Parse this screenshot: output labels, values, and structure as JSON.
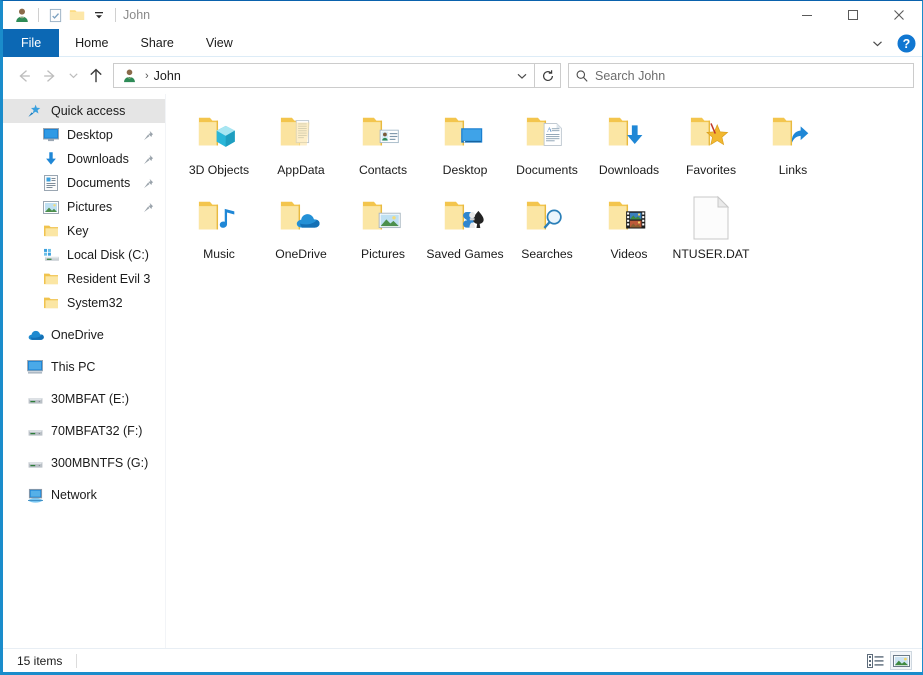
{
  "window": {
    "title": "John",
    "accent_color": "#1a8ccb",
    "tab_active_color": "#0c68b4",
    "selection_color": "#e5e5e5"
  },
  "quick_access_toolbar": {
    "items": [
      {
        "name": "user-account-icon",
        "label": ""
      },
      {
        "name": "properties-icon",
        "label": ""
      },
      {
        "name": "new-folder-icon",
        "label": ""
      },
      {
        "name": "customize-dropdown-icon",
        "label": ""
      }
    ]
  },
  "window_controls": {
    "minimize": "—",
    "maximize": "□",
    "close": "✕"
  },
  "ribbon": {
    "tabs": [
      {
        "label": "File",
        "active": true
      },
      {
        "label": "Home",
        "active": false
      },
      {
        "label": "Share",
        "active": false
      },
      {
        "label": "View",
        "active": false
      }
    ],
    "expand_label": "",
    "help_label": "?"
  },
  "address_bar": {
    "back_label": "",
    "forward_label": "",
    "recent_label": "",
    "up_label": "",
    "breadcrumb_separator": "›",
    "breadcrumb": "John",
    "dropdown_label": "",
    "refresh_label": ""
  },
  "search": {
    "value": "",
    "placeholder": "Search John"
  },
  "sidebar": {
    "items": [
      {
        "label": "Quick access",
        "icon": "star-pin-icon",
        "level": 0,
        "selected": true,
        "pinned": false
      },
      {
        "label": "Desktop",
        "icon": "desktop-icon",
        "level": 1,
        "selected": false,
        "pinned": true
      },
      {
        "label": "Downloads",
        "icon": "downloads-icon",
        "level": 1,
        "selected": false,
        "pinned": true
      },
      {
        "label": "Documents",
        "icon": "documents-icon",
        "level": 1,
        "selected": false,
        "pinned": true
      },
      {
        "label": "Pictures",
        "icon": "pictures-icon",
        "level": 1,
        "selected": false,
        "pinned": true
      },
      {
        "label": "Key",
        "icon": "folder-icon",
        "level": 1,
        "selected": false,
        "pinned": false
      },
      {
        "label": "Local Disk (C:)",
        "icon": "harddrive-icon",
        "level": 1,
        "selected": false,
        "pinned": false
      },
      {
        "label": "Resident Evil 3",
        "icon": "folder-icon",
        "level": 1,
        "selected": false,
        "pinned": false
      },
      {
        "label": "System32",
        "icon": "folder-icon",
        "level": 1,
        "selected": false,
        "pinned": false
      },
      {
        "label": "OneDrive",
        "icon": "onedrive-icon",
        "level": 0,
        "selected": false,
        "pinned": false,
        "gap_before": true
      },
      {
        "label": "This PC",
        "icon": "thispc-icon",
        "level": 0,
        "selected": false,
        "pinned": false,
        "gap_before": true
      },
      {
        "label": "30MBFAT (E:)",
        "icon": "drive-icon",
        "level": 0,
        "selected": false,
        "pinned": false,
        "gap_before": true
      },
      {
        "label": "70MBFAT32 (F:)",
        "icon": "drive-icon",
        "level": 0,
        "selected": false,
        "pinned": false,
        "gap_before": true
      },
      {
        "label": "300MBNTFS (G:)",
        "icon": "drive-icon",
        "level": 0,
        "selected": false,
        "pinned": false,
        "gap_before": true
      },
      {
        "label": "Network",
        "icon": "network-icon",
        "level": 0,
        "selected": false,
        "pinned": false,
        "gap_before": true
      }
    ]
  },
  "content": {
    "items": [
      {
        "label": "3D Objects",
        "icon": "folder-3dobjects-icon"
      },
      {
        "label": "AppData",
        "icon": "folder-appdata-icon"
      },
      {
        "label": "Contacts",
        "icon": "folder-contacts-icon"
      },
      {
        "label": "Desktop",
        "icon": "folder-desktop-icon"
      },
      {
        "label": "Documents",
        "icon": "folder-documents-icon"
      },
      {
        "label": "Downloads",
        "icon": "folder-downloads-icon"
      },
      {
        "label": "Favorites",
        "icon": "folder-favorites-icon"
      },
      {
        "label": "Links",
        "icon": "folder-links-icon"
      },
      {
        "label": "Music",
        "icon": "folder-music-icon"
      },
      {
        "label": "OneDrive",
        "icon": "folder-onedrive-icon"
      },
      {
        "label": "Pictures",
        "icon": "folder-pictures-icon"
      },
      {
        "label": "Saved Games",
        "icon": "folder-savedgames-icon"
      },
      {
        "label": "Searches",
        "icon": "folder-searches-icon"
      },
      {
        "label": "Videos",
        "icon": "folder-videos-icon"
      },
      {
        "label": "NTUSER.DAT",
        "icon": "generic-file-icon"
      }
    ]
  },
  "status_bar": {
    "item_count": "15 items",
    "views": [
      {
        "name": "details-view-button",
        "active": false
      },
      {
        "name": "large-icons-view-button",
        "active": true
      }
    ]
  }
}
